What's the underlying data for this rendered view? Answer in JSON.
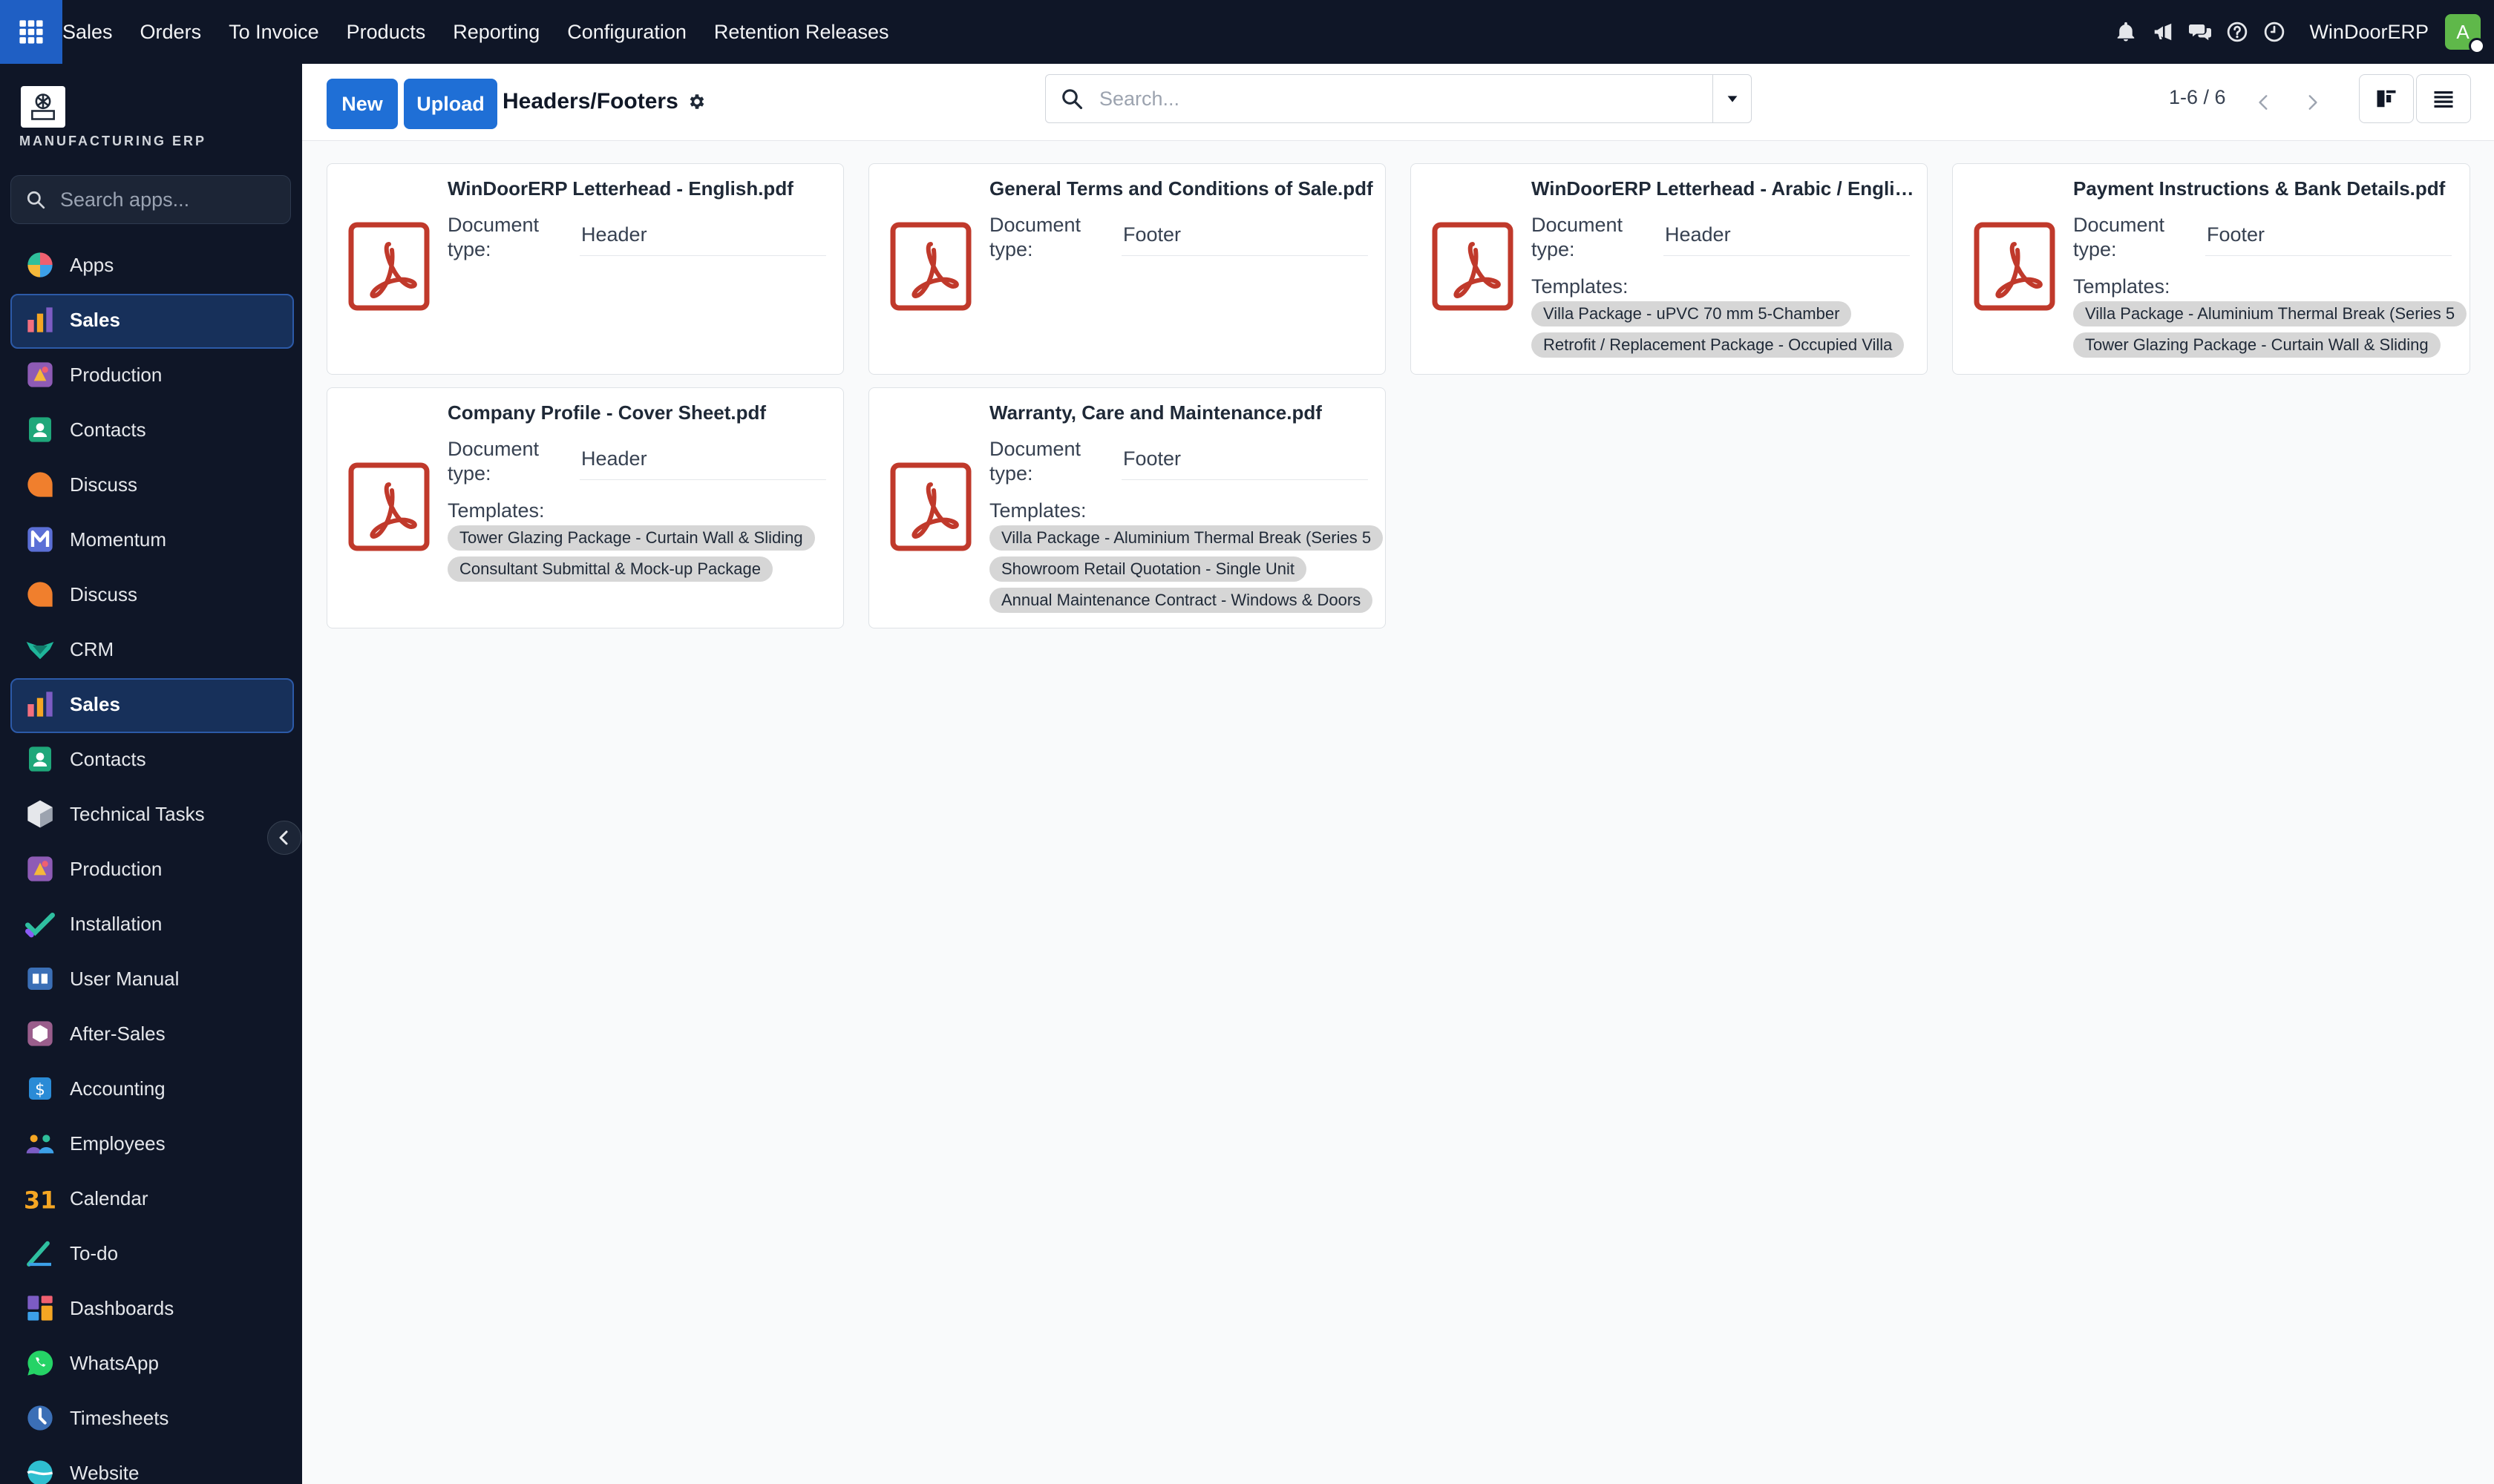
{
  "topbar": {
    "nav": [
      "Sales",
      "Orders",
      "To Invoice",
      "Products",
      "Reporting",
      "Configuration",
      "Retention Releases"
    ],
    "company": "WinDoorERP",
    "avatar_letter": "A"
  },
  "sidebar": {
    "brand_text": "MANUFACTURING ERP",
    "search_placeholder": "Search apps...",
    "items": [
      {
        "label": "Apps",
        "icon": "apps-pie-icon"
      },
      {
        "label": "Sales",
        "icon": "sales-chart-icon",
        "active": true
      },
      {
        "label": "Production",
        "icon": "production-icon"
      },
      {
        "label": "Contacts",
        "icon": "contacts-icon"
      },
      {
        "label": "Discuss",
        "icon": "discuss-icon"
      },
      {
        "label": "Momentum",
        "icon": "momentum-icon"
      },
      {
        "label": "Discuss",
        "icon": "discuss-icon"
      },
      {
        "label": "CRM",
        "icon": "crm-icon"
      },
      {
        "label": "Sales",
        "icon": "sales-chart-icon",
        "active": true
      },
      {
        "label": "Contacts",
        "icon": "contacts-icon"
      },
      {
        "label": "Technical Tasks",
        "icon": "technical-tasks-icon"
      },
      {
        "label": "Production",
        "icon": "production-icon"
      },
      {
        "label": "Installation",
        "icon": "installation-icon"
      },
      {
        "label": "User Manual",
        "icon": "user-manual-icon"
      },
      {
        "label": "After-Sales",
        "icon": "after-sales-icon"
      },
      {
        "label": "Accounting",
        "icon": "accounting-icon"
      },
      {
        "label": "Employees",
        "icon": "employees-icon"
      },
      {
        "label": "Calendar",
        "icon": "calendar-icon"
      },
      {
        "label": "To-do",
        "icon": "todo-icon"
      },
      {
        "label": "Dashboards",
        "icon": "dashboards-icon"
      },
      {
        "label": "WhatsApp",
        "icon": "whatsapp-icon"
      },
      {
        "label": "Timesheets",
        "icon": "timesheets-icon"
      },
      {
        "label": "Website",
        "icon": "website-icon"
      }
    ]
  },
  "control_panel": {
    "new_label": "New",
    "upload_label": "Upload",
    "title": "Headers/Footers",
    "search_placeholder": "Search...",
    "pager": "1-6 / 6"
  },
  "labels": {
    "document_type_line1": "Document",
    "document_type_line2": "type:",
    "templates": "Templates:"
  },
  "cards": [
    {
      "name": "WinDoorERP Letterhead - English.pdf",
      "doc_type": "Header",
      "templates": []
    },
    {
      "name": "General Terms and Conditions of Sale.pdf",
      "doc_type": "Footer",
      "templates": []
    },
    {
      "name": "WinDoorERP Letterhead - Arabic / English.pdf",
      "doc_type": "Header",
      "templates": [
        "Villa Package - uPVC 70 mm 5-Chamber",
        "Retrofit / Replacement Package - Occupied Villa"
      ]
    },
    {
      "name": "Payment Instructions & Bank Details.pdf",
      "doc_type": "Footer",
      "templates": [
        "Villa Package - Aluminium Thermal Break (Series 5",
        "Tower Glazing Package - Curtain Wall & Sliding"
      ]
    },
    {
      "name": "Company Profile - Cover Sheet.pdf",
      "doc_type": "Header",
      "templates": [
        "Tower Glazing Package - Curtain Wall & Sliding",
        "Consultant Submittal & Mock-up Package"
      ]
    },
    {
      "name": "Warranty, Care and Maintenance.pdf",
      "doc_type": "Footer",
      "templates": [
        "Villa Package - Aluminium Thermal Break (Series 5",
        "Showroom Retail Quotation - Single Unit",
        "Annual Maintenance Contract - Windows & Doors"
      ]
    }
  ],
  "colors": {
    "topbar_bg": "#0f1627",
    "accent": "#1f6fd6",
    "pdf_red": "#c0392b",
    "tag_bg": "#d6d6d6"
  }
}
